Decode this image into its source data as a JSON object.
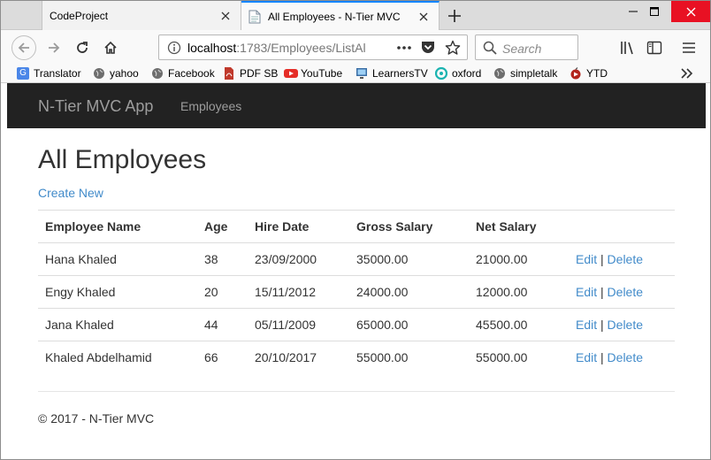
{
  "browser": {
    "tabs": [
      {
        "title": "CodeProject"
      },
      {
        "title": "All Employees - N-Tier MVC"
      }
    ],
    "url_host": "localhost",
    "url_path": ":1783/Employees/ListAl",
    "search_placeholder": "Search",
    "bookmarks": [
      {
        "label": "Translator",
        "icon": "translator-icon"
      },
      {
        "label": "yahoo",
        "icon": "globe-icon"
      },
      {
        "label": "Facebook",
        "icon": "globe-icon"
      },
      {
        "label": "PDF SB",
        "icon": "pdf-icon"
      },
      {
        "label": "YouTube",
        "icon": "youtube-icon"
      },
      {
        "label": "LearnersTV",
        "icon": "monitor-icon"
      },
      {
        "label": "oxford",
        "icon": "oxford-icon"
      },
      {
        "label": "simpletalk",
        "icon": "globe-icon"
      },
      {
        "label": "YTD",
        "icon": "ytd-icon"
      }
    ]
  },
  "site": {
    "brand": "N-Tier MVC App",
    "nav_employees": "Employees"
  },
  "page": {
    "title": "All Employees",
    "create_new": "Create New",
    "columns": [
      "Employee Name",
      "Age",
      "Hire Date",
      "Gross Salary",
      "Net Salary"
    ],
    "rows": [
      {
        "name": "Hana Khaled",
        "age": "38",
        "hire_date": "23/09/2000",
        "gross": "35000.00",
        "net": "21000.00"
      },
      {
        "name": "Engy Khaled",
        "age": "20",
        "hire_date": "15/11/2012",
        "gross": "24000.00",
        "net": "12000.00"
      },
      {
        "name": "Jana Khaled",
        "age": "44",
        "hire_date": "05/11/2009",
        "gross": "65000.00",
        "net": "45500.00"
      },
      {
        "name": "Khaled Abdelhamid",
        "age": "66",
        "hire_date": "20/10/2017",
        "gross": "55000.00",
        "net": "55000.00"
      }
    ],
    "edit_label": "Edit",
    "separator": "|",
    "delete_label": "Delete",
    "footer": "© 2017 - N-Tier MVC"
  },
  "colors": {
    "navbar_bg": "#222222",
    "nav_text": "#9d9d9d",
    "link": "#428bca",
    "close_button": "#e81123",
    "active_tab_accent": "#0a84ff"
  }
}
